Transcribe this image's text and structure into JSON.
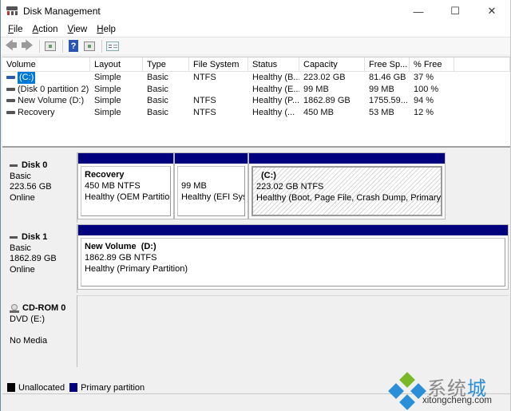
{
  "window": {
    "title": "Disk Management",
    "controls": {
      "minimize": "—",
      "maximize": "☐",
      "close": "✕"
    }
  },
  "menu": [
    {
      "label": "File",
      "accel": "F",
      "rest": "ile"
    },
    {
      "label": "Action",
      "accel": "A",
      "rest": "ction"
    },
    {
      "label": "View",
      "accel": "V",
      "rest": "iew"
    },
    {
      "label": "Help",
      "accel": "H",
      "rest": "elp"
    }
  ],
  "toolbar": {
    "back_icon": "arrow-left",
    "forward_icon": "arrow-right",
    "help_glyph": "?"
  },
  "volume_list": {
    "columns": [
      "Volume",
      "Layout",
      "Type",
      "File System",
      "Status",
      "Capacity",
      "Free Sp...",
      "% Free",
      ""
    ],
    "rows": [
      {
        "volume": "(C:)",
        "layout": "Simple",
        "type": "Basic",
        "fs": "NTFS",
        "status": "Healthy (B...",
        "capacity": "223.02 GB",
        "free": "81.46 GB",
        "pct": "37 %",
        "selected": true
      },
      {
        "volume": "(Disk 0 partition 2)",
        "layout": "Simple",
        "type": "Basic",
        "fs": "",
        "status": "Healthy (E...",
        "capacity": "99 MB",
        "free": "99 MB",
        "pct": "100 %",
        "selected": false
      },
      {
        "volume": "New Volume (D:)",
        "layout": "Simple",
        "type": "Basic",
        "fs": "NTFS",
        "status": "Healthy (P...",
        "capacity": "1862.89 GB",
        "free": "1755.59...",
        "pct": "94 %",
        "selected": false
      },
      {
        "volume": "Recovery",
        "layout": "Simple",
        "type": "Basic",
        "fs": "NTFS",
        "status": "Healthy (...",
        "capacity": "450 MB",
        "free": "53 MB",
        "pct": "12 %",
        "selected": false
      }
    ]
  },
  "disks": [
    {
      "name": "Disk 0",
      "type": "Basic",
      "size": "223.56 GB",
      "state": "Online",
      "partitions": [
        {
          "name": "Recovery",
          "size": "450 MB NTFS",
          "status": "Healthy (OEM Partition)"
        },
        {
          "name": "",
          "size": "99 MB",
          "status": "Healthy (EFI System Partition)"
        },
        {
          "name": "(C:)",
          "size": "223.02 GB NTFS",
          "status": "Healthy (Boot, Page File, Crash Dump, Primary Partition)"
        }
      ]
    },
    {
      "name": "Disk 1",
      "type": "Basic",
      "size": "1862.89 GB",
      "state": "Online",
      "partitions": [
        {
          "name": "New Volume  (D:)",
          "size": "1862.89 GB NTFS",
          "status": "Healthy (Primary Partition)"
        }
      ]
    },
    {
      "name": "CD-ROM 0",
      "type": "DVD (E:)",
      "size": "",
      "state": "No Media",
      "partitions": []
    }
  ],
  "legend": [
    {
      "label": "Unallocated",
      "color": "#000000"
    },
    {
      "label": "Primary partition",
      "color": "#00007f"
    }
  ],
  "watermark": {
    "cn_gray": "系统",
    "cn_blue": "城",
    "url": "xitongcheng.com",
    "colors": {
      "green": "#7ab828",
      "blue": "#2a8ed8"
    }
  }
}
